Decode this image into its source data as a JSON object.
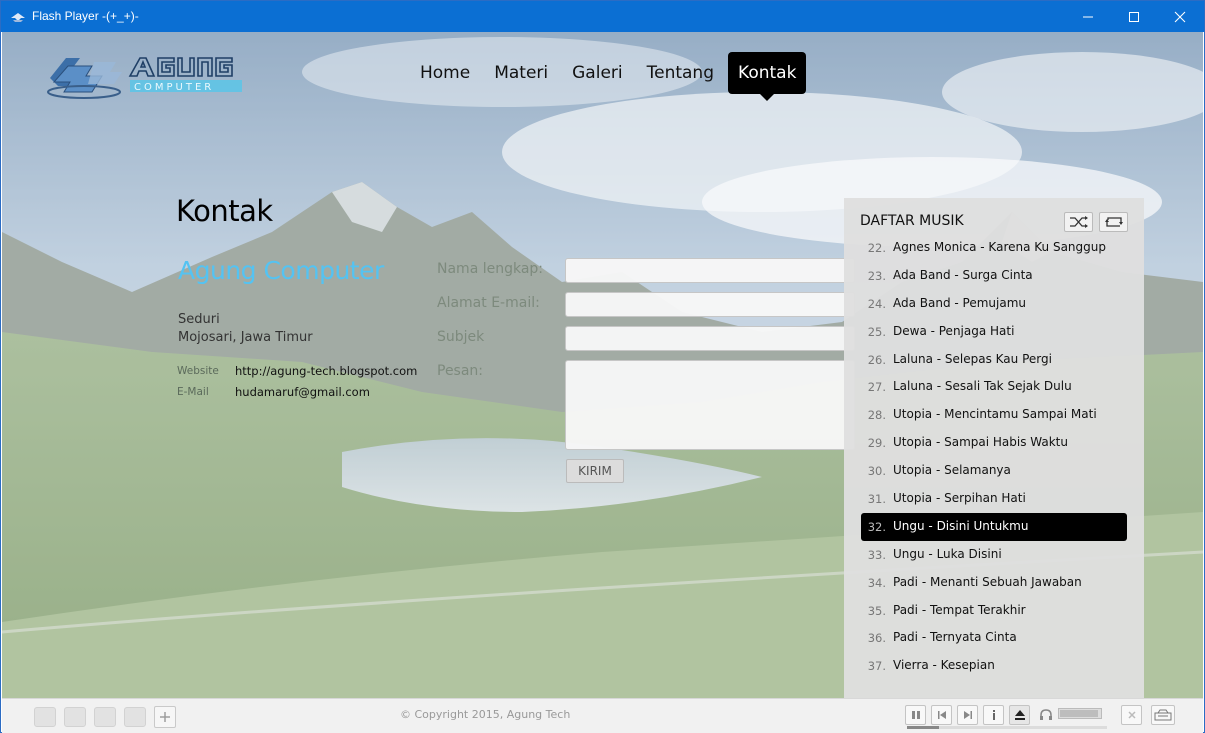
{
  "window": {
    "title": "Flash Player  -(+_+)-"
  },
  "nav": {
    "items": [
      "Home",
      "Materi",
      "Galeri",
      "Tentang",
      "Kontak"
    ],
    "active": "Kontak"
  },
  "contact": {
    "title": "Kontak",
    "company": "Agung Computer",
    "address_line1": "Seduri",
    "address_line2": "Mojosari, Jawa Timur",
    "website_label": "Website",
    "website_value": "http://agung-tech.blogspot.com",
    "email_label": "E-Mail",
    "email_value": "hudamaruf@gmail.com",
    "form": {
      "name_label": "Nama lengkap:",
      "email_label": "Alamat E-mail:",
      "subject_label": "Subjek",
      "message_label": "Pesan:",
      "submit_label": "KIRIM"
    }
  },
  "playlist": {
    "title": "DAFTAR MUSIK",
    "items": [
      {
        "num": "22.",
        "name": "Agnes Monica - Karena Ku Sanggup"
      },
      {
        "num": "23.",
        "name": "Ada Band - Surga Cinta"
      },
      {
        "num": "24.",
        "name": "Ada Band - Pemujamu"
      },
      {
        "num": "25.",
        "name": "Dewa - Penjaga Hati"
      },
      {
        "num": "26.",
        "name": "Laluna - Selepas Kau Pergi"
      },
      {
        "num": "27.",
        "name": "Laluna - Sesali Tak Sejak Dulu"
      },
      {
        "num": "28.",
        "name": "Utopia - Mencintamu Sampai Mati"
      },
      {
        "num": "29.",
        "name": "Utopia - Sampai Habis Waktu"
      },
      {
        "num": "30.",
        "name": "Utopia - Selamanya"
      },
      {
        "num": "31.",
        "name": "Utopia - Serpihan Hati"
      },
      {
        "num": "32.",
        "name": "Ungu - Disini Untukmu"
      },
      {
        "num": "33.",
        "name": "Ungu - Luka Disini"
      },
      {
        "num": "34.",
        "name": "Padi - Menanti Sebuah Jawaban"
      },
      {
        "num": "35.",
        "name": "Padi - Tempat Terakhir"
      },
      {
        "num": "36.",
        "name": "Padi - Ternyata Cinta"
      },
      {
        "num": "37.",
        "name": "Vierra - Kesepian"
      }
    ],
    "selected_index": 10
  },
  "footer": {
    "copyright": "© Copyright 2015, Agung Tech",
    "volume_fraction": 0.9,
    "seek_fraction": 0.16
  },
  "icons": {
    "shuffle": "shuffle-icon",
    "repeat": "repeat-icon",
    "pause": "pause-icon",
    "prev": "previous-icon",
    "next": "next-icon",
    "info": "info-icon",
    "eject": "eject-icon",
    "headphones": "headphones-icon",
    "close": "close-icon",
    "keyboard": "keyboard-icon"
  },
  "colors": {
    "titlebar": "#0b6fd3",
    "company": "#54c3f2",
    "selected_song": "#000000",
    "nav_active": "#000000"
  }
}
